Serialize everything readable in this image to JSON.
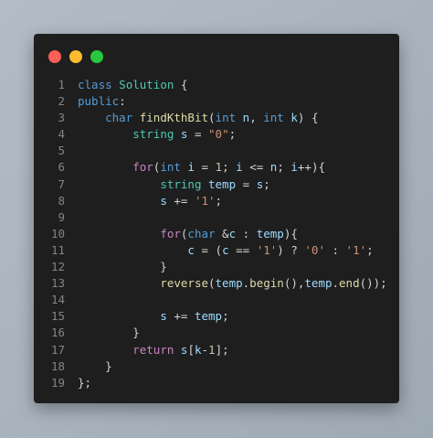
{
  "window": {
    "dots": [
      {
        "name": "close",
        "color": "#ff5f57"
      },
      {
        "name": "minimize",
        "color": "#febc2e"
      },
      {
        "name": "maximize",
        "color": "#28c840"
      }
    ]
  },
  "code": {
    "lines": [
      {
        "n": "1",
        "tokens": [
          [
            "kw",
            "class"
          ],
          [
            "pl",
            " "
          ],
          [
            "ty",
            "Solution"
          ],
          [
            "pl",
            " {"
          ]
        ]
      },
      {
        "n": "2",
        "tokens": [
          [
            "kw",
            "public"
          ],
          [
            "pl",
            ":"
          ]
        ]
      },
      {
        "n": "3",
        "tokens": [
          [
            "pl",
            "    "
          ],
          [
            "kw",
            "char"
          ],
          [
            "pl",
            " "
          ],
          [
            "fn",
            "findKthBit"
          ],
          [
            "pl",
            "("
          ],
          [
            "kw",
            "int"
          ],
          [
            "pl",
            " "
          ],
          [
            "var",
            "n"
          ],
          [
            "pl",
            ", "
          ],
          [
            "kw",
            "int"
          ],
          [
            "pl",
            " "
          ],
          [
            "var",
            "k"
          ],
          [
            "pl",
            ") {"
          ]
        ]
      },
      {
        "n": "4",
        "tokens": [
          [
            "pl",
            "        "
          ],
          [
            "ty",
            "string"
          ],
          [
            "pl",
            " "
          ],
          [
            "var",
            "s"
          ],
          [
            "pl",
            " = "
          ],
          [
            "str",
            "\"0\""
          ],
          [
            "pl",
            ";"
          ]
        ]
      },
      {
        "n": "5",
        "tokens": []
      },
      {
        "n": "6",
        "tokens": [
          [
            "pl",
            "        "
          ],
          [
            "ctl",
            "for"
          ],
          [
            "pl",
            "("
          ],
          [
            "kw",
            "int"
          ],
          [
            "pl",
            " "
          ],
          [
            "var",
            "i"
          ],
          [
            "pl",
            " = "
          ],
          [
            "num",
            "1"
          ],
          [
            "pl",
            "; "
          ],
          [
            "var",
            "i"
          ],
          [
            "pl",
            " <= "
          ],
          [
            "var",
            "n"
          ],
          [
            "pl",
            "; "
          ],
          [
            "var",
            "i"
          ],
          [
            "pl",
            "++){"
          ]
        ]
      },
      {
        "n": "7",
        "tokens": [
          [
            "pl",
            "            "
          ],
          [
            "ty",
            "string"
          ],
          [
            "pl",
            " "
          ],
          [
            "var",
            "temp"
          ],
          [
            "pl",
            " = "
          ],
          [
            "var",
            "s"
          ],
          [
            "pl",
            ";"
          ]
        ]
      },
      {
        "n": "8",
        "tokens": [
          [
            "pl",
            "            "
          ],
          [
            "var",
            "s"
          ],
          [
            "pl",
            " += "
          ],
          [
            "str",
            "'1'"
          ],
          [
            "pl",
            ";"
          ]
        ]
      },
      {
        "n": "9",
        "tokens": []
      },
      {
        "n": "10",
        "tokens": [
          [
            "pl",
            "            "
          ],
          [
            "ctl",
            "for"
          ],
          [
            "pl",
            "("
          ],
          [
            "kw",
            "char"
          ],
          [
            "pl",
            " &"
          ],
          [
            "var",
            "c"
          ],
          [
            "pl",
            " : "
          ],
          [
            "var",
            "temp"
          ],
          [
            "pl",
            "){"
          ]
        ]
      },
      {
        "n": "11",
        "tokens": [
          [
            "pl",
            "                "
          ],
          [
            "var",
            "c"
          ],
          [
            "pl",
            " = ("
          ],
          [
            "var",
            "c"
          ],
          [
            "pl",
            " == "
          ],
          [
            "str",
            "'1'"
          ],
          [
            "pl",
            ") ? "
          ],
          [
            "str",
            "'0'"
          ],
          [
            "pl",
            " : "
          ],
          [
            "str",
            "'1'"
          ],
          [
            "pl",
            ";"
          ]
        ]
      },
      {
        "n": "12",
        "tokens": [
          [
            "pl",
            "            }"
          ]
        ]
      },
      {
        "n": "13",
        "tokens": [
          [
            "pl",
            "            "
          ],
          [
            "fn",
            "reverse"
          ],
          [
            "pl",
            "("
          ],
          [
            "var",
            "temp"
          ],
          [
            "pl",
            "."
          ],
          [
            "fn",
            "begin"
          ],
          [
            "pl",
            "(),"
          ],
          [
            "var",
            "temp"
          ],
          [
            "pl",
            "."
          ],
          [
            "fn",
            "end"
          ],
          [
            "pl",
            "());"
          ]
        ]
      },
      {
        "n": "14",
        "tokens": []
      },
      {
        "n": "15",
        "tokens": [
          [
            "pl",
            "            "
          ],
          [
            "var",
            "s"
          ],
          [
            "pl",
            " += "
          ],
          [
            "var",
            "temp"
          ],
          [
            "pl",
            ";"
          ]
        ]
      },
      {
        "n": "16",
        "tokens": [
          [
            "pl",
            "        }"
          ]
        ]
      },
      {
        "n": "17",
        "tokens": [
          [
            "pl",
            "        "
          ],
          [
            "ctl",
            "return"
          ],
          [
            "pl",
            " "
          ],
          [
            "var",
            "s"
          ],
          [
            "pl",
            "["
          ],
          [
            "var",
            "k"
          ],
          [
            "pl",
            "-"
          ],
          [
            "num",
            "1"
          ],
          [
            "pl",
            "];"
          ]
        ]
      },
      {
        "n": "18",
        "tokens": [
          [
            "pl",
            "    }"
          ]
        ]
      },
      {
        "n": "19",
        "tokens": [
          [
            "pl",
            "};"
          ]
        ]
      }
    ]
  }
}
